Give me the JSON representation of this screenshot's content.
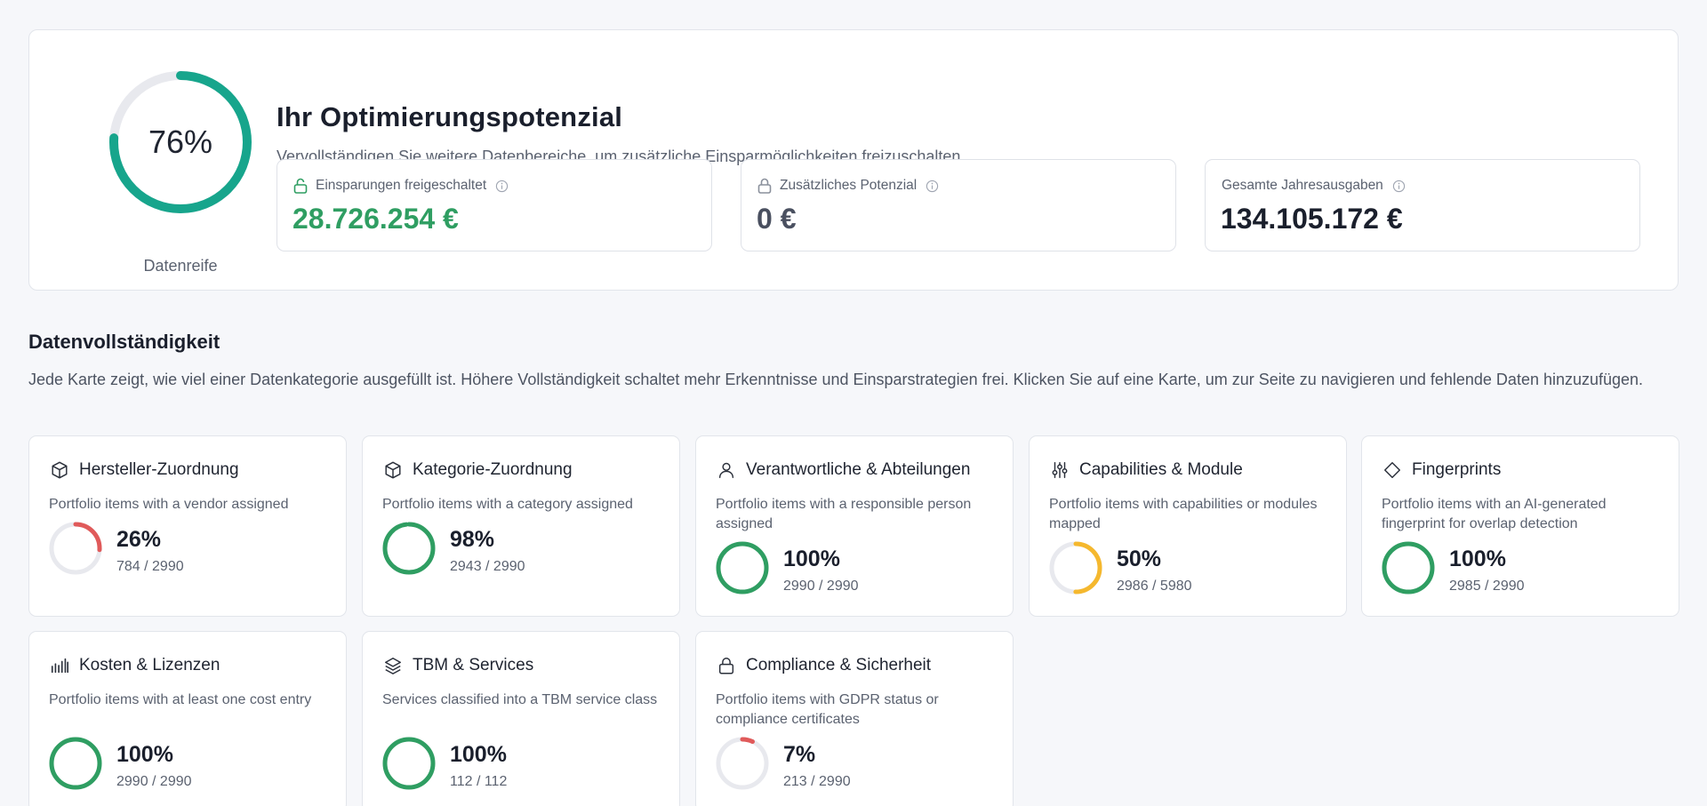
{
  "summary": {
    "maturity_value": "76%",
    "maturity_fraction": 0.76,
    "maturity_caption": "Datenreife",
    "title": "Ihr Optimierungspotenzial",
    "subtitle": "Vervollständigen Sie weitere Datenbereiche, um zusätzliche Einsparmöglichkeiten freizuschalten",
    "metrics": [
      {
        "label": "Einsparungen freigeschaltet",
        "value": "28.726.254 €",
        "icon": "unlock-icon"
      },
      {
        "label": "Zusätzliches Potenzial",
        "value": "0 €",
        "icon": "lock-icon"
      },
      {
        "label": "Gesamte Jahresausgaben",
        "value": "134.105.172 €",
        "icon": "info-icon"
      }
    ]
  },
  "section": {
    "title": "Datenvollständigkeit",
    "description": "Jede Karte zeigt, wie viel einer Datenkategorie ausgefüllt ist. Höhere Vollständigkeit schaltet mehr Erkenntnisse und Einsparstrategien frei. Klicken Sie auf eine Karte, um zur Seite zu navigieren und fehlende Daten hinzuzufügen."
  },
  "cards": [
    {
      "title": "Hersteller-Zuordnung",
      "icon": "box-icon",
      "desc": "Portfolio items with a vendor assigned",
      "pct": "26%",
      "fraction": 0.26,
      "count": "784 / 2990"
    },
    {
      "title": "Kategorie-Zuordnung",
      "icon": "box-icon",
      "desc": "Portfolio items with a category assigned",
      "pct": "98%",
      "fraction": 0.98,
      "count": "2943 / 2990"
    },
    {
      "title": "Verantwortliche & Abteilungen",
      "icon": "user-icon",
      "desc": "Portfolio items with a responsible person assigned",
      "pct": "100%",
      "fraction": 1.0,
      "count": "2990 / 2990"
    },
    {
      "title": "Capabilities & Module",
      "icon": "sliders-icon",
      "desc": "Portfolio items with capabilities or modules mapped",
      "pct": "50%",
      "fraction": 0.5,
      "count": "2986 / 5980"
    },
    {
      "title": "Fingerprints",
      "icon": "diamond-icon",
      "desc": "Portfolio items with an AI-generated fingerprint for overlap detection",
      "pct": "100%",
      "fraction": 1.0,
      "count": "2985 / 2990"
    },
    {
      "title": "Kosten & Lizenzen",
      "icon": "bar-chart-icon",
      "desc": "Portfolio items with at least one cost entry",
      "pct": "100%",
      "fraction": 1.0,
      "count": "2990 / 2990"
    },
    {
      "title": "TBM & Services",
      "icon": "layers-icon",
      "desc": "Services classified into a TBM service class",
      "pct": "100%",
      "fraction": 1.0,
      "count": "112 / 112"
    },
    {
      "title": "Compliance & Sicherheit",
      "icon": "lock-icon",
      "desc": "Portfolio items with GDPR status or compliance certificates",
      "pct": "7%",
      "fraction": 0.07,
      "count": "213 / 2990"
    }
  ],
  "colors": {
    "teal": "#17a58c",
    "green": "#2f9e62",
    "red": "#e05a5a",
    "amber": "#f5b82e",
    "track": "#e8e9ee"
  }
}
